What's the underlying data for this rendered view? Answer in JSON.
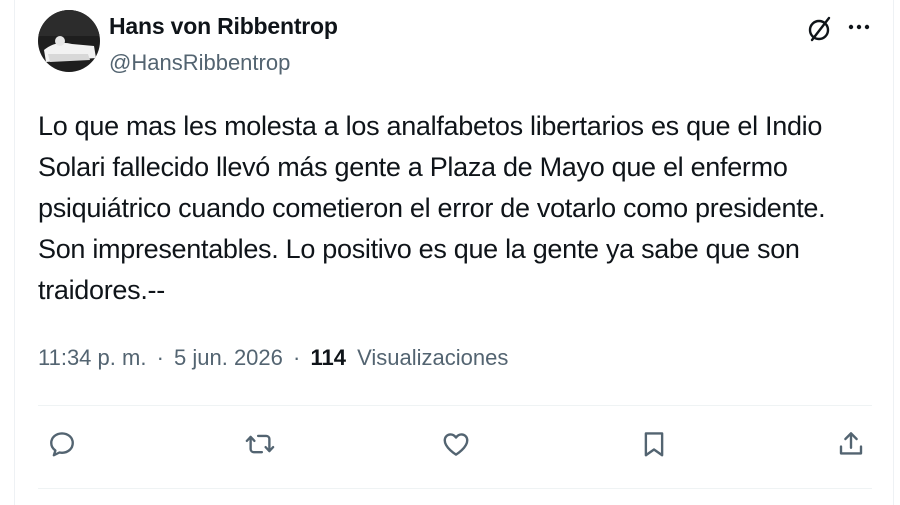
{
  "author": {
    "display_name": "Hans von Ribbentrop",
    "handle": "@HansRibbentrop"
  },
  "tweet": {
    "lines": [
      "Lo que mas les molesta a los analfabetos libertarios es que el Indio",
      "Solari fallecido llevó más gente a Plaza de Mayo que el enfermo",
      "psiquiátrico cuando cometieron el error de votarlo como presidente.",
      "Son impresentables. Lo positivo es que la gente ya sabe que son",
      "traidores.--"
    ]
  },
  "meta": {
    "time": "11:34 p. m.",
    "separator": "·",
    "date": "5 jun. 2026",
    "views_count": "114",
    "views_label": "Visualizaciones"
  },
  "icons": {
    "grok": "grok-icon",
    "more": "more-icon",
    "reply": "reply-icon",
    "repost": "repost-icon",
    "like": "like-icon",
    "bookmark": "bookmark-icon",
    "share": "share-icon"
  },
  "colors": {
    "text": "#0f1419",
    "secondary": "#536471",
    "divider": "#eff3f4"
  }
}
